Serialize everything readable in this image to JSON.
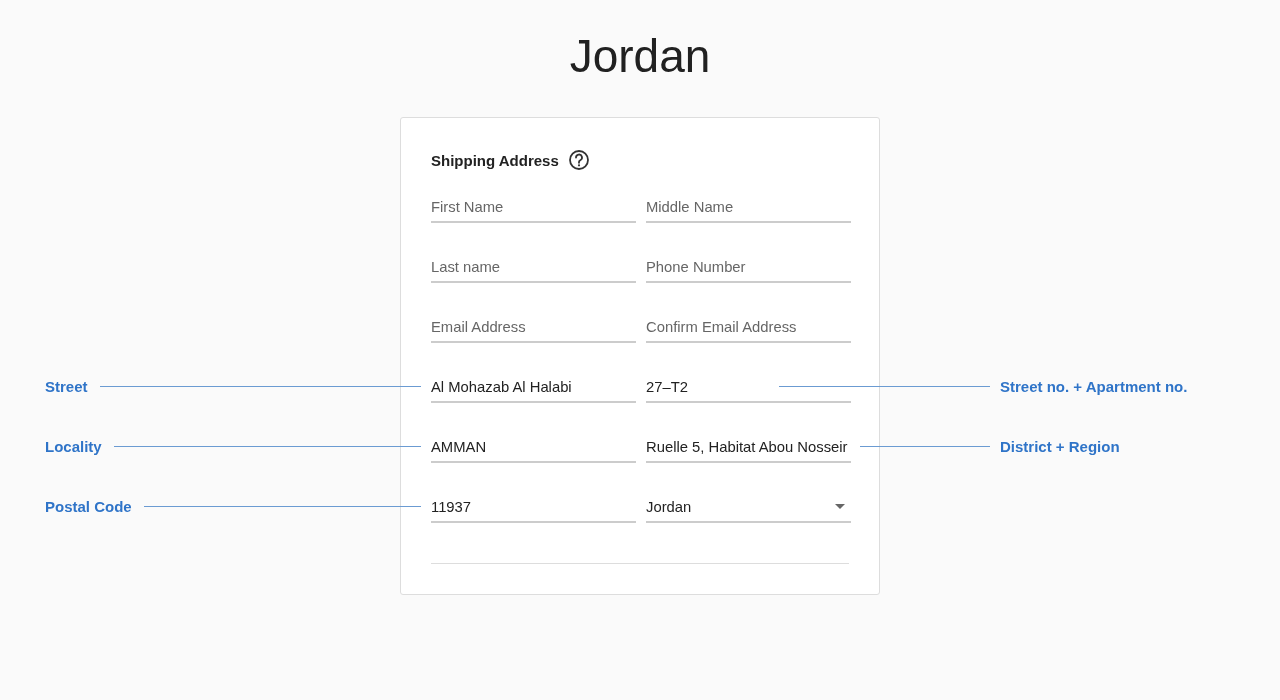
{
  "page_title": "Jordan",
  "form": {
    "heading": "Shipping Address",
    "fields": [
      {
        "kind": "text",
        "placeholder": "First Name"
      },
      {
        "kind": "text",
        "placeholder": "Middle Name"
      },
      {
        "kind": "text",
        "placeholder": "Last name"
      },
      {
        "kind": "text",
        "placeholder": "Phone Number"
      },
      {
        "kind": "text",
        "placeholder": "Email Address"
      },
      {
        "kind": "text",
        "placeholder": "Confirm Email Address"
      },
      {
        "kind": "text",
        "value": "Al Mohazab Al Halabi",
        "annotation": "Street"
      },
      {
        "kind": "text",
        "value": "27–T2",
        "annotation": "Street no. + Apartment no."
      },
      {
        "kind": "text",
        "value": "AMMAN",
        "annotation": "Locality"
      },
      {
        "kind": "text",
        "value": "Ruelle 5, Habitat Abou Nosseir",
        "annotation": "District + Region"
      },
      {
        "kind": "text",
        "value": "11937",
        "annotation": "Postal Code"
      },
      {
        "kind": "select",
        "value": "Jordan"
      }
    ]
  }
}
